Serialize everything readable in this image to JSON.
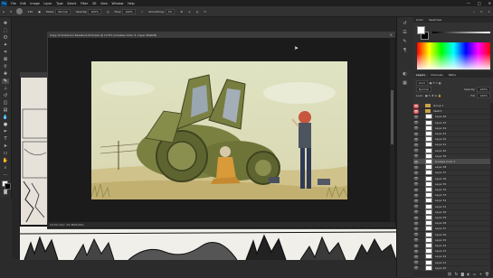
{
  "app": {
    "logo": "Ps",
    "menu": [
      "File",
      "Edit",
      "Image",
      "Layer",
      "Type",
      "Select",
      "Filter",
      "3D",
      "View",
      "Window",
      "Help"
    ],
    "window_controls": [
      "—",
      "□",
      "✕"
    ]
  },
  "options_bar": {
    "size": "135",
    "mode_label": "Mode:",
    "mode_value": "Normal",
    "opacity_label": "Opacity:",
    "opacity_value": "100%",
    "flow_label": "Flow:",
    "flow_value": "100%",
    "smoothing_label": "Smoothing:",
    "smoothing_value": "0%"
  },
  "document": {
    "tab_title": "Copy of Anderson Kasakura-Vol3.psd @ 12.5% (Lineless Color 2, Layer Mask/8)",
    "status": "12.5%   Doc: 43.3M/9.69G",
    "zoom": "12.5%"
  },
  "panels": {
    "color_tabs": [
      "Color",
      "Swatches"
    ],
    "colors": {
      "foreground": "#ffffff",
      "background": "#000000"
    },
    "layer_tabs": [
      "Layers",
      "Channels",
      "Paths"
    ],
    "blend_mode": "Normal",
    "opacity_label": "Opacity:",
    "opacity_value": "100%",
    "lock_label": "Lock:",
    "fill_label": "Fill:",
    "fill_value": "100%",
    "search_label": "Kind",
    "layers": [
      {
        "name": "Group 1",
        "type": "group",
        "red": true
      },
      {
        "name": "Sketch",
        "type": "group",
        "red": true
      },
      {
        "name": "Layer 46"
      },
      {
        "name": "Layer 45"
      },
      {
        "name": "Layer 44"
      },
      {
        "name": "Layer 43"
      },
      {
        "name": "Layer 42"
      },
      {
        "name": "Layer 41"
      },
      {
        "name": "Layer 40"
      },
      {
        "name": "Layer 39"
      },
      {
        "name": "Lineless Color 2",
        "selected": true
      },
      {
        "name": "Layer 38"
      },
      {
        "name": "Layer 37"
      },
      {
        "name": "Layer 36"
      },
      {
        "name": "Layer 35"
      },
      {
        "name": "Layer 34"
      },
      {
        "name": "Layer 33"
      },
      {
        "name": "Layer 32"
      },
      {
        "name": "Layer 31"
      },
      {
        "name": "Layer 30"
      },
      {
        "name": "Layer 29"
      },
      {
        "name": "Layer 28"
      },
      {
        "name": "Layer 27"
      },
      {
        "name": "Layer 26"
      },
      {
        "name": "Layer 25"
      },
      {
        "name": "Layer 24"
      },
      {
        "name": "Layer 23"
      },
      {
        "name": "Layer 22"
      },
      {
        "name": "Layer 21"
      },
      {
        "name": "Layer 20"
      }
    ],
    "footer_icons": [
      "link-icon",
      "fx-icon",
      "mask-icon",
      "adjustment-icon",
      "folder-icon",
      "new-layer-icon",
      "trash-icon"
    ]
  }
}
